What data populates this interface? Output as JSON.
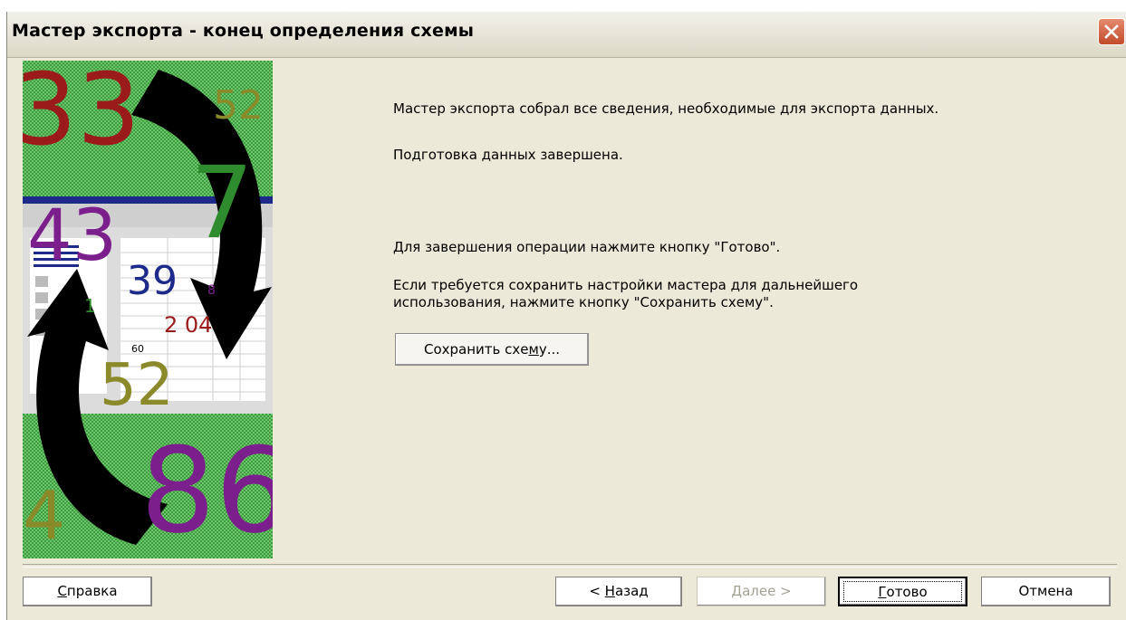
{
  "window": {
    "title": "Мастер экспорта - конец определения схемы",
    "close_icon": "close-icon",
    "colors": {
      "title_bg": "#ece9d8",
      "close_btn": "#d45c3e",
      "body_bg": "#ece9d8"
    }
  },
  "wizard_image": {
    "numbers": [
      "33",
      "52",
      "7",
      "43",
      "39",
      "8",
      "1",
      "2 04",
      "60",
      "52",
      "86",
      "4"
    ],
    "colors": {
      "green": "#2e8b2e",
      "red": "#9b1b1b",
      "olive": "#8a8a2a",
      "purple": "#7b1f8c",
      "navy": "#1e2a8a",
      "black": "#000000"
    }
  },
  "messages": {
    "collected": "Мастер экспорта собрал все сведения, необходимые для экспорта данных.",
    "prepared": "Подготовка данных завершена.",
    "press_finish": "Для завершения операции нажмите кнопку \"Готово\".",
    "save_hint_line1": "Если требуется сохранить настройки мастера для дальнейшего",
    "save_hint_line2": "использования, нажмите кнопку \"Сохранить схему\"."
  },
  "buttons": {
    "save_scheme": {
      "before": "Сохранить схе",
      "underline": "м",
      "after": "у..."
    },
    "help": {
      "underline": "С",
      "after": "правка"
    },
    "back": {
      "before": "< ",
      "underline": "Н",
      "after": "азад"
    },
    "next": {
      "underline": "Д",
      "after": "алее >",
      "enabled": false
    },
    "finish": {
      "underline": "Г",
      "after": "отово",
      "default": true
    },
    "cancel": {
      "label": "Отмена"
    }
  }
}
